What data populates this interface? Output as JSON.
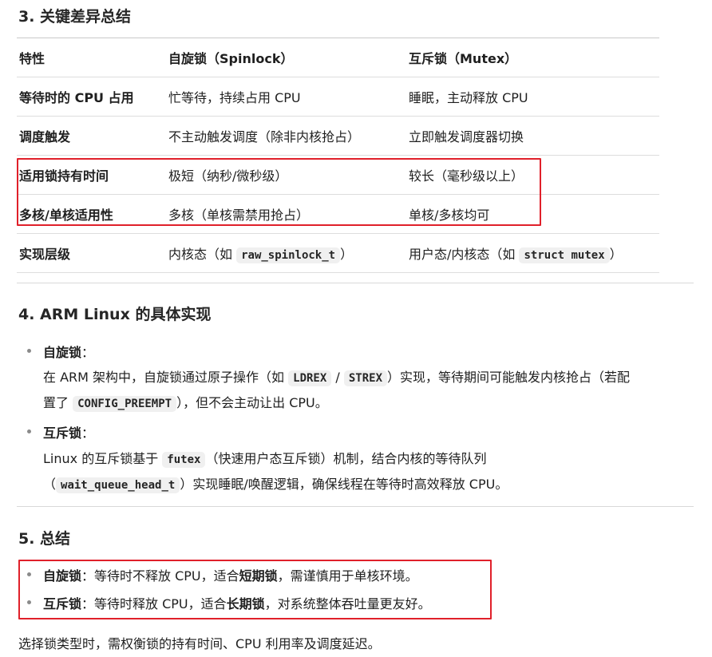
{
  "section3": {
    "heading": "3. 关键差异总结",
    "table": {
      "headers": [
        "特性",
        "自旋锁（Spinlock）",
        "互斥锁（Mutex）"
      ],
      "rows": [
        [
          "等待时的 CPU 占用",
          "忙等待，持续占用 CPU",
          "睡眠，主动释放 CPU"
        ],
        [
          "调度触发",
          "不主动触发调度（除非内核抢占）",
          "立即触发调度器切换"
        ],
        [
          "适用锁持有时间",
          "极短（纳秒/微秒级）",
          "较长（毫秒级以上）"
        ],
        [
          "多核/单核适用性",
          "多核（单核需禁用抢占）",
          "单核/多核均可"
        ]
      ],
      "last_row": {
        "feature": "实现层级",
        "spin_prefix": "内核态（如 ",
        "spin_code": "raw_spinlock_t",
        "spin_suffix": "）",
        "mutex_prefix": "用户态/内核态（如 ",
        "mutex_code": "struct mutex",
        "mutex_suffix": "）"
      }
    }
  },
  "section4": {
    "heading": "4. ARM Linux 的具体实现",
    "spin": {
      "title": "自旋锁",
      "colon": "：",
      "l1_a": "在 ARM 架构中，自旋锁通过原子操作（如 ",
      "code1": "LDREX",
      "sep": " / ",
      "code2": "STREX",
      "l1_b": "）实现，等待期间可能触发内核抢占（若配",
      "l2_a": "置了 ",
      "code3": "CONFIG_PREEMPT",
      "l2_b": "），但不会主动让出 CPU。"
    },
    "mutex": {
      "title": "互斥锁",
      "colon": "：",
      "l1_a": "Linux 的互斥锁基于 ",
      "code1": "futex",
      "l1_b": "（快速用户态互斥锁）机制，结合内核的等待队列",
      "l2_a": "（",
      "code2": "wait_queue_head_t",
      "l2_b": "）实现睡眠/唤醒逻辑，确保线程在等待时高效释放 CPU。"
    }
  },
  "section5": {
    "heading": "5. 总结",
    "items": [
      {
        "title": "自旋锁",
        "a": "：等待时不释放 CPU，适合",
        "strong": "短期锁",
        "b": "，需谨慎用于单核环境。"
      },
      {
        "title": "互斥锁",
        "a": "：等待时释放 CPU，适合",
        "strong": "长期锁",
        "b": "，对系统整体吞吐量更友好。"
      }
    ],
    "closing": "选择锁类型时，需权衡锁的持有时间、CPU 利用率及调度延迟。"
  },
  "colors": {
    "highlight_box": "#e0202a",
    "code_bg": "#f0f0f0"
  }
}
